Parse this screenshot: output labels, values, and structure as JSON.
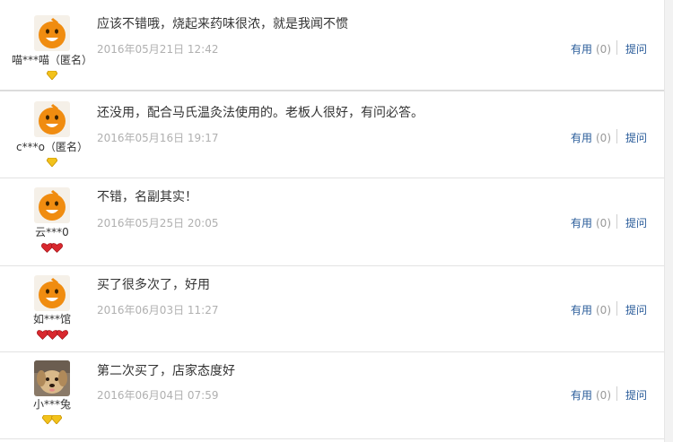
{
  "reviews": [
    {
      "username": "喵***喵（匿名）",
      "comment": "应该不错哦，烧起来药味很浓，就是我闻不惯",
      "date": "2016年05月21日 12:42",
      "useful_label": "有用",
      "useful_count": "(0)",
      "ask_label": "提问",
      "avatar": "orange-mascot",
      "badge_icon": "gold-diamond-icon",
      "badge_count": 1
    },
    {
      "username": "c***o（匿名）",
      "comment": "还没用，配合马氏温灸法使用的。老板人很好，有问必答。",
      "date": "2016年05月16日 19:17",
      "useful_label": "有用",
      "useful_count": "(0)",
      "ask_label": "提问",
      "avatar": "orange-mascot",
      "badge_icon": "gold-diamond-icon",
      "badge_count": 1
    },
    {
      "username": "云***0",
      "comment": "不错，名副其实！",
      "date": "2016年05月25日 20:05",
      "useful_label": "有用",
      "useful_count": "(0)",
      "ask_label": "提问",
      "avatar": "orange-mascot",
      "badge_icon": "red-heart-icon",
      "badge_count": 2
    },
    {
      "username": "如***馆",
      "comment": "买了很多次了，好用",
      "date": "2016年06月03日 11:27",
      "useful_label": "有用",
      "useful_count": "(0)",
      "ask_label": "提问",
      "avatar": "orange-mascot",
      "badge_icon": "red-heart-icon",
      "badge_count": 3
    },
    {
      "username": "小***兔",
      "comment": "第二次买了，店家态度好",
      "date": "2016年06月04日 07:59",
      "useful_label": "有用",
      "useful_count": "(0)",
      "ask_label": "提问",
      "avatar": "dog-photo",
      "badge_icon": "gold-diamond-icon",
      "badge_count": 2
    }
  ],
  "colors": {
    "link": "#2a5c9a",
    "date": "#b0b0b0",
    "mascot": "#f08c10",
    "gold": "#f2c21b",
    "red": "#d8282e"
  }
}
